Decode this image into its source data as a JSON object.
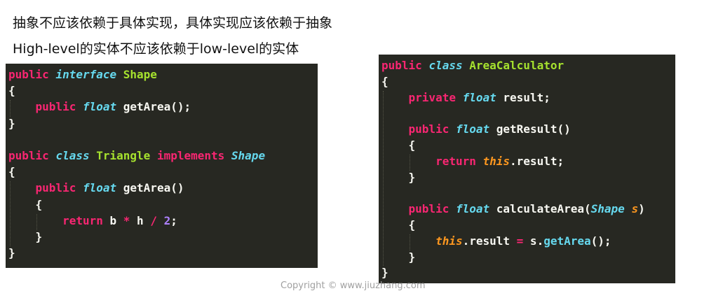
{
  "heading": {
    "line1": "抽象不应该依赖于具体实现，具体实现应该依赖于抽象",
    "line2": "High-level的实体不应该依赖于low-level的实体"
  },
  "code_left": [
    [
      {
        "t": "public ",
        "c": "kw"
      },
      {
        "t": "interface",
        "c": "type"
      },
      {
        "t": " Shape",
        "c": "cls"
      }
    ],
    [
      {
        "t": "{",
        "c": "brace"
      }
    ],
    [
      {
        "t": "    public ",
        "c": "kw"
      },
      {
        "t": "float",
        "c": "type"
      },
      {
        "t": " getArea();",
        "c": "plain"
      }
    ],
    [
      {
        "t": "}",
        "c": "brace"
      }
    ],
    [],
    [
      {
        "t": "public ",
        "c": "kw"
      },
      {
        "t": "class",
        "c": "type"
      },
      {
        "t": " Triangle ",
        "c": "cls"
      },
      {
        "t": "implements ",
        "c": "kw"
      },
      {
        "t": "Shape",
        "c": "type"
      }
    ],
    [
      {
        "t": "{",
        "c": "brace"
      }
    ],
    [
      {
        "t": "    public ",
        "c": "kw"
      },
      {
        "t": "float",
        "c": "type"
      },
      {
        "t": " getArea()",
        "c": "plain"
      }
    ],
    [
      {
        "t": "    {",
        "c": "brace"
      }
    ],
    [
      {
        "t": "        return ",
        "c": "kw"
      },
      {
        "t": "b ",
        "c": "plain"
      },
      {
        "t": "*",
        "c": "op"
      },
      {
        "t": " h ",
        "c": "plain"
      },
      {
        "t": "/",
        "c": "op"
      },
      {
        "t": " ",
        "c": "plain"
      },
      {
        "t": "2",
        "c": "num"
      },
      {
        "t": ";",
        "c": "plain"
      }
    ],
    [
      {
        "t": "    }",
        "c": "brace"
      }
    ],
    [
      {
        "t": "}",
        "c": "brace"
      }
    ]
  ],
  "code_right": [
    [
      {
        "t": "public ",
        "c": "kw"
      },
      {
        "t": "class",
        "c": "type"
      },
      {
        "t": " AreaCalculator",
        "c": "cls"
      }
    ],
    [
      {
        "t": "{",
        "c": "brace"
      }
    ],
    [
      {
        "t": "    private ",
        "c": "kw"
      },
      {
        "t": "float",
        "c": "type"
      },
      {
        "t": " result;",
        "c": "plain"
      }
    ],
    [],
    [
      {
        "t": "    public ",
        "c": "kw"
      },
      {
        "t": "float",
        "c": "type"
      },
      {
        "t": " getResult()",
        "c": "plain"
      }
    ],
    [
      {
        "t": "    {",
        "c": "brace"
      }
    ],
    [
      {
        "t": "        return ",
        "c": "kw"
      },
      {
        "t": "this",
        "c": "this"
      },
      {
        "t": ".result;",
        "c": "plain"
      }
    ],
    [
      {
        "t": "    }",
        "c": "brace"
      }
    ],
    [],
    [
      {
        "t": "    public ",
        "c": "kw"
      },
      {
        "t": "float",
        "c": "type"
      },
      {
        "t": " calculateArea(",
        "c": "plain"
      },
      {
        "t": "Shape",
        "c": "type"
      },
      {
        "t": " ",
        "c": "plain"
      },
      {
        "t": "s",
        "c": "param"
      },
      {
        "t": ")",
        "c": "plain"
      }
    ],
    [
      {
        "t": "    {",
        "c": "brace"
      }
    ],
    [
      {
        "t": "        ",
        "c": "plain"
      },
      {
        "t": "this",
        "c": "this"
      },
      {
        "t": ".result ",
        "c": "plain"
      },
      {
        "t": "=",
        "c": "op"
      },
      {
        "t": " s.",
        "c": "plain"
      },
      {
        "t": "getArea",
        "c": "meth"
      },
      {
        "t": "();",
        "c": "plain"
      }
    ],
    [
      {
        "t": "    }",
        "c": "brace"
      }
    ],
    [
      {
        "t": "}",
        "c": "brace"
      }
    ]
  ],
  "watermark": "Copyright © www.jiuzhang.com",
  "colors": {
    "editor_bg": "#272822",
    "keyword": "#f92672",
    "type": "#66d9ef",
    "class_name": "#a6e22e",
    "number": "#ae81ff",
    "this_param": "#fd971f",
    "text": "#f8f8f2"
  }
}
